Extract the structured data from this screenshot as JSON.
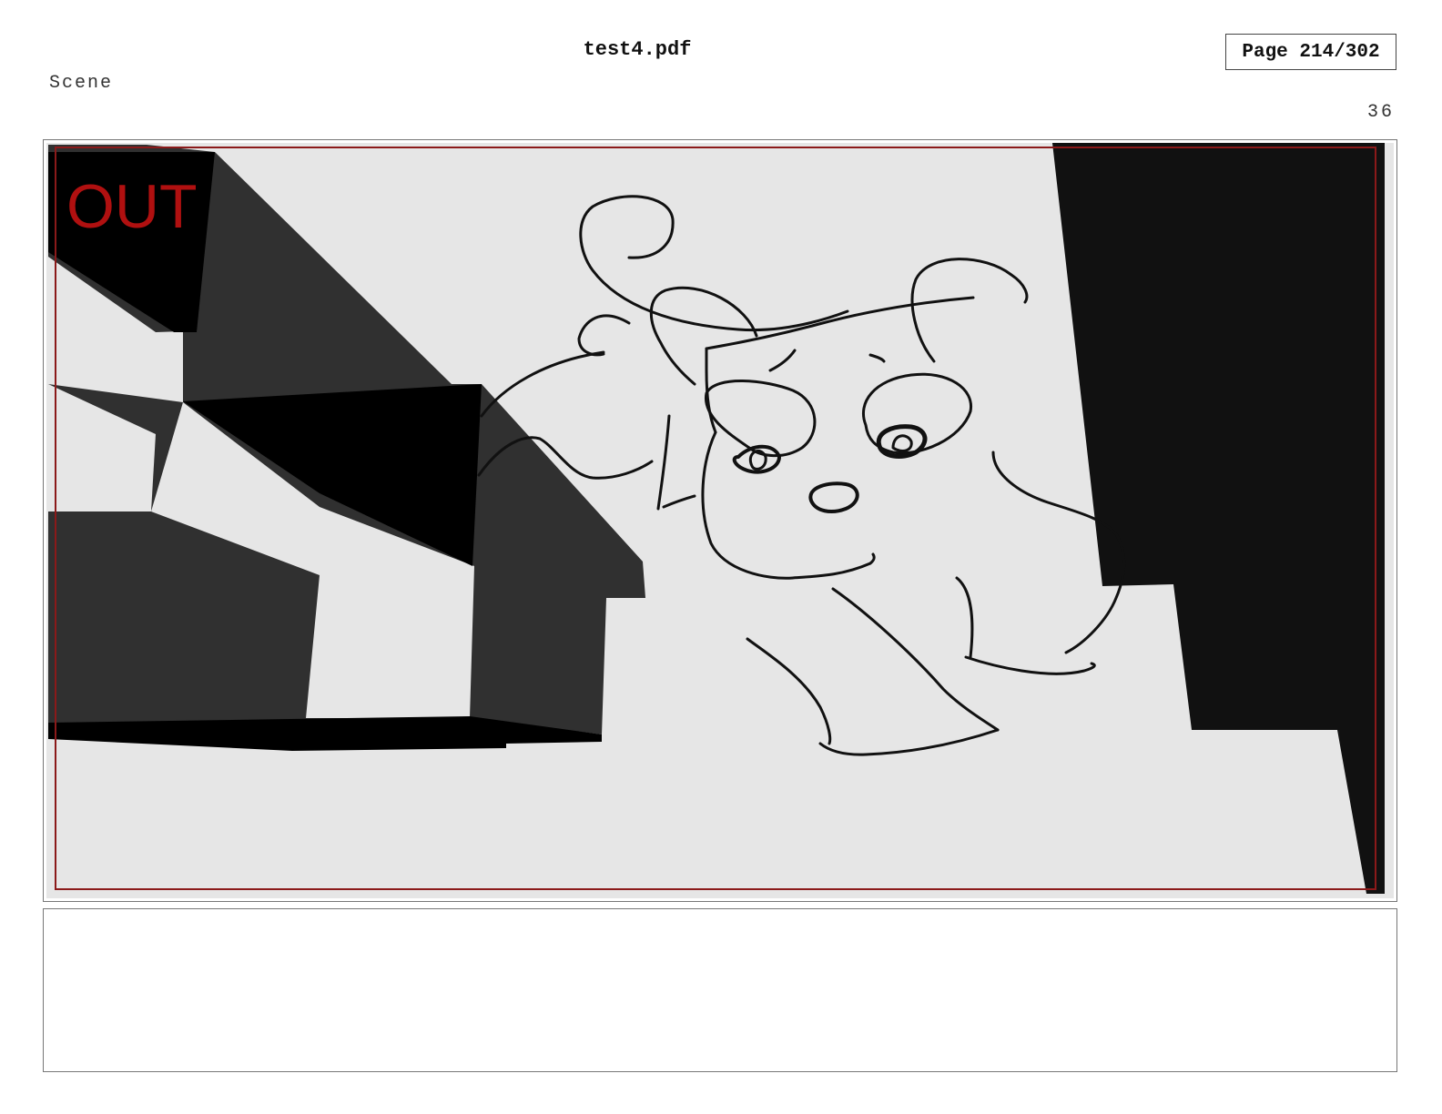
{
  "document": {
    "title": "test4.pdf",
    "page_indicator": "Page 214/302",
    "current_page": 214,
    "total_pages": 302
  },
  "scene": {
    "label": "Scene",
    "panel_number": "36"
  },
  "panel": {
    "overlay_text": "OUT",
    "overlay_color": "#b01010",
    "safe_area_color": "#8b1a1a",
    "background_color": "#e6e6e6",
    "sketch_description_icon": "character-sketch-drawing"
  },
  "notes": {
    "text": ""
  }
}
